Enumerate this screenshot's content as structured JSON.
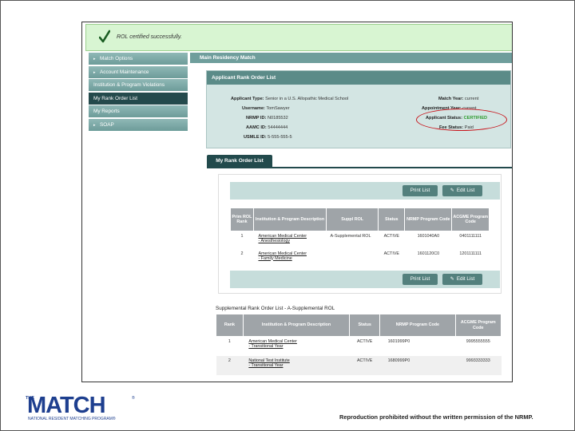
{
  "banner": {
    "message": "ROL certified successfully."
  },
  "sidebar": {
    "items": [
      {
        "label": "Match Options",
        "arrow": "▸"
      },
      {
        "label": "Account Maintenance",
        "arrow": "▸"
      },
      {
        "label": "Institution & Program Violations",
        "arrow": ""
      },
      {
        "label": "My Rank Order List",
        "arrow": ""
      },
      {
        "label": "My Reports",
        "arrow": ""
      },
      {
        "label": "SOAP",
        "arrow": "▸"
      }
    ]
  },
  "main": {
    "header": "Main Residency Match"
  },
  "applicant_panel": {
    "title": "Applicant Rank Order List",
    "left": [
      {
        "label": "Applicant Type:",
        "value": "Senior in a U.S. Allopathic Medical School"
      },
      {
        "label": "Username:",
        "value": "TomSawyer"
      },
      {
        "label": "NRMP ID:",
        "value": "N0185532"
      },
      {
        "label": "AAMC ID:",
        "value": "54444444"
      },
      {
        "label": "USMLE ID:",
        "value": "5-555-555-5"
      }
    ],
    "right": [
      {
        "label": "Match Year:",
        "value": "current"
      },
      {
        "label": "Appointment Year:",
        "value": "current"
      },
      {
        "label": "Applicant Status:",
        "value": "CERTIFIED"
      },
      {
        "label": "Fee Status:",
        "value": "Paid"
      }
    ]
  },
  "tab": {
    "label": "My Rank Order List"
  },
  "buttons": {
    "print": "Print List",
    "edit": "Edit List"
  },
  "primary_table": {
    "headers": [
      "Prim ROL Rank",
      "Institution & Program Description",
      "Suppl ROL",
      "Status",
      "NRMP Program Code",
      "ACGME Program Code"
    ],
    "rows": [
      {
        "rank": "1",
        "inst": "American Medical Center",
        "prog": "- Anesthesiology",
        "suppl": "A-Supplemental ROL",
        "status": "ACTIVE",
        "nrmp": "1601040A0",
        "acgme": "0401111111"
      },
      {
        "rank": "2",
        "inst": "American Medical Center",
        "prog": "- Family Medicine",
        "suppl": "",
        "status": "ACTIVE",
        "nrmp": "1601120C0",
        "acgme": "1201111111"
      }
    ]
  },
  "supplemental": {
    "title": "Supplemental Rank Order List - A-Supplemental ROL",
    "headers": [
      "Rank",
      "Institution & Program Description",
      "Status",
      "NRMP Program Code",
      "ACGME Program Code"
    ],
    "rows": [
      {
        "rank": "1",
        "inst": "American Medical Center",
        "prog": "- Transitional Year",
        "status": "ACTIVE",
        "nrmp": "1601999P0",
        "acgme": "9995555555"
      },
      {
        "rank": "2",
        "inst": "National Test Institute",
        "prog": "- Transitional Year",
        "status": "ACTIVE",
        "nrmp": "1680999P0",
        "acgme": "9993333333"
      }
    ]
  },
  "footer": {
    "logo_the": "THE",
    "logo_word": "MATCH",
    "logo_tm": "®",
    "logo_sub": "NATIONAL RESIDENT MATCHING PROGRAM®",
    "notice": "Reproduction prohibited without the written permission of the NRMP."
  }
}
